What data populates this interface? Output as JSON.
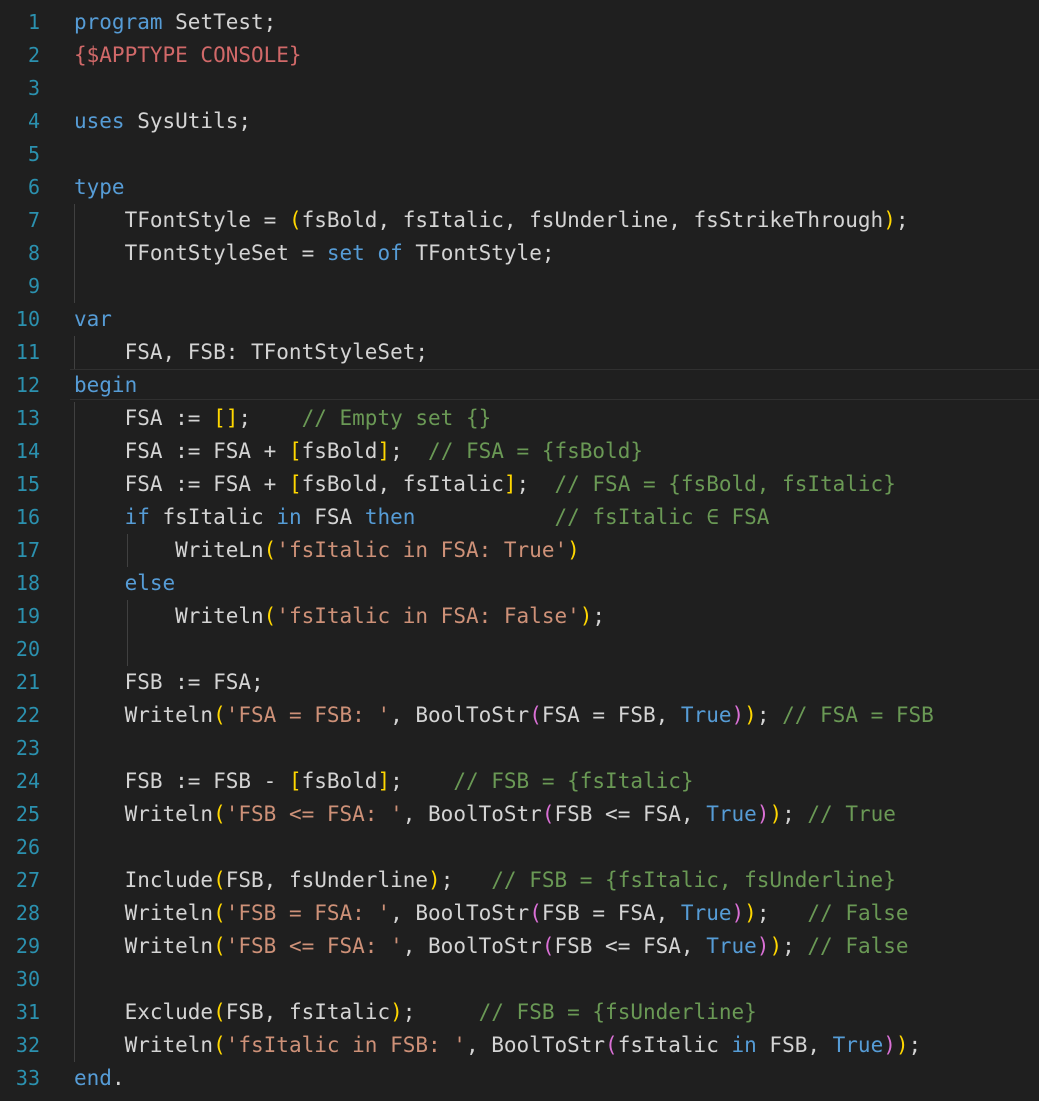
{
  "editor": {
    "line_numbers": [
      "1",
      "2",
      "3",
      "4",
      "5",
      "6",
      "7",
      "8",
      "9",
      "10",
      "11",
      "12",
      "13",
      "14",
      "15",
      "16",
      "17",
      "18",
      "19",
      "20",
      "21",
      "22",
      "23",
      "24",
      "25",
      "26",
      "27",
      "28",
      "29",
      "30",
      "31",
      "32",
      "33"
    ],
    "lines": [
      [
        {
          "t": "program",
          "c": "kw"
        },
        {
          "t": " SetTest;",
          "c": "txt"
        }
      ],
      [
        {
          "t": "{$APPTYPE CONSOLE}",
          "c": "dir"
        }
      ],
      [],
      [
        {
          "t": "uses",
          "c": "kw"
        },
        {
          "t": " SysUtils;",
          "c": "txt"
        }
      ],
      [],
      [
        {
          "t": "type",
          "c": "kw"
        }
      ],
      [
        {
          "t": "    TFontStyle = ",
          "c": "txt"
        },
        {
          "t": "(",
          "c": "brk"
        },
        {
          "t": "fsBold, fsItalic, fsUnderline, fsStrikeThrough",
          "c": "txt"
        },
        {
          "t": ")",
          "c": "brk"
        },
        {
          "t": ";",
          "c": "txt"
        }
      ],
      [
        {
          "t": "    TFontStyleSet = ",
          "c": "txt"
        },
        {
          "t": "set",
          "c": "kw"
        },
        {
          "t": " ",
          "c": "txt"
        },
        {
          "t": "of",
          "c": "kw"
        },
        {
          "t": " TFontStyle;",
          "c": "txt"
        }
      ],
      [],
      [
        {
          "t": "var",
          "c": "kw"
        }
      ],
      [
        {
          "t": "    FSA, FSB: TFontStyleSet;",
          "c": "txt"
        }
      ],
      [
        {
          "t": "begin",
          "c": "kw"
        }
      ],
      [
        {
          "t": "    FSA := ",
          "c": "txt"
        },
        {
          "t": "[]",
          "c": "brk"
        },
        {
          "t": ";    ",
          "c": "txt"
        },
        {
          "t": "// Empty set {}",
          "c": "cmt"
        }
      ],
      [
        {
          "t": "    FSA := FSA + ",
          "c": "txt"
        },
        {
          "t": "[",
          "c": "brk"
        },
        {
          "t": "fsBold",
          "c": "txt"
        },
        {
          "t": "]",
          "c": "brk"
        },
        {
          "t": ";  ",
          "c": "txt"
        },
        {
          "t": "// FSA = {fsBold}",
          "c": "cmt"
        }
      ],
      [
        {
          "t": "    FSA := FSA + ",
          "c": "txt"
        },
        {
          "t": "[",
          "c": "brk"
        },
        {
          "t": "fsBold, fsItalic",
          "c": "txt"
        },
        {
          "t": "]",
          "c": "brk"
        },
        {
          "t": ";  ",
          "c": "txt"
        },
        {
          "t": "// FSA = {fsBold, fsItalic}",
          "c": "cmt"
        }
      ],
      [
        {
          "t": "    ",
          "c": "txt"
        },
        {
          "t": "if",
          "c": "kw"
        },
        {
          "t": " fsItalic ",
          "c": "txt"
        },
        {
          "t": "in",
          "c": "kw"
        },
        {
          "t": " FSA ",
          "c": "txt"
        },
        {
          "t": "then",
          "c": "kw"
        },
        {
          "t": "           ",
          "c": "txt"
        },
        {
          "t": "// fsItalic ∈ FSA",
          "c": "cmt"
        }
      ],
      [
        {
          "t": "        WriteLn",
          "c": "txt"
        },
        {
          "t": "(",
          "c": "brk"
        },
        {
          "t": "'fsItalic in FSA: True'",
          "c": "str"
        },
        {
          "t": ")",
          "c": "brk"
        }
      ],
      [
        {
          "t": "    ",
          "c": "txt"
        },
        {
          "t": "else",
          "c": "kw"
        }
      ],
      [
        {
          "t": "        Writeln",
          "c": "txt"
        },
        {
          "t": "(",
          "c": "brk"
        },
        {
          "t": "'fsItalic in FSA: False'",
          "c": "str"
        },
        {
          "t": ")",
          "c": "brk"
        },
        {
          "t": ";",
          "c": "txt"
        }
      ],
      [],
      [
        {
          "t": "    FSB := FSA;",
          "c": "txt"
        }
      ],
      [
        {
          "t": "    Writeln",
          "c": "txt"
        },
        {
          "t": "(",
          "c": "brk"
        },
        {
          "t": "'FSA = FSB: '",
          "c": "str"
        },
        {
          "t": ", BoolToStr",
          "c": "txt"
        },
        {
          "t": "(",
          "c": "par"
        },
        {
          "t": "FSA = FSB, ",
          "c": "txt"
        },
        {
          "t": "True",
          "c": "kw"
        },
        {
          "t": ")",
          "c": "par"
        },
        {
          "t": ")",
          "c": "brk"
        },
        {
          "t": "; ",
          "c": "txt"
        },
        {
          "t": "// FSA = FSB",
          "c": "cmt"
        }
      ],
      [],
      [
        {
          "t": "    FSB := FSB - ",
          "c": "txt"
        },
        {
          "t": "[",
          "c": "brk"
        },
        {
          "t": "fsBold",
          "c": "txt"
        },
        {
          "t": "]",
          "c": "brk"
        },
        {
          "t": ";    ",
          "c": "txt"
        },
        {
          "t": "// FSB = {fsItalic}",
          "c": "cmt"
        }
      ],
      [
        {
          "t": "    Writeln",
          "c": "txt"
        },
        {
          "t": "(",
          "c": "brk"
        },
        {
          "t": "'FSB <= FSA: '",
          "c": "str"
        },
        {
          "t": ", BoolToStr",
          "c": "txt"
        },
        {
          "t": "(",
          "c": "par"
        },
        {
          "t": "FSB <= FSA, ",
          "c": "txt"
        },
        {
          "t": "True",
          "c": "kw"
        },
        {
          "t": ")",
          "c": "par"
        },
        {
          "t": ")",
          "c": "brk"
        },
        {
          "t": "; ",
          "c": "txt"
        },
        {
          "t": "// True",
          "c": "cmt"
        }
      ],
      [],
      [
        {
          "t": "    Include",
          "c": "txt"
        },
        {
          "t": "(",
          "c": "brk"
        },
        {
          "t": "FSB, fsUnderline",
          "c": "txt"
        },
        {
          "t": ")",
          "c": "brk"
        },
        {
          "t": ";   ",
          "c": "txt"
        },
        {
          "t": "// FSB = {fsItalic, fsUnderline}",
          "c": "cmt"
        }
      ],
      [
        {
          "t": "    Writeln",
          "c": "txt"
        },
        {
          "t": "(",
          "c": "brk"
        },
        {
          "t": "'FSB = FSA: '",
          "c": "str"
        },
        {
          "t": ", BoolToStr",
          "c": "txt"
        },
        {
          "t": "(",
          "c": "par"
        },
        {
          "t": "FSB = FSA, ",
          "c": "txt"
        },
        {
          "t": "True",
          "c": "kw"
        },
        {
          "t": ")",
          "c": "par"
        },
        {
          "t": ")",
          "c": "brk"
        },
        {
          "t": ";   ",
          "c": "txt"
        },
        {
          "t": "// False",
          "c": "cmt"
        }
      ],
      [
        {
          "t": "    Writeln",
          "c": "txt"
        },
        {
          "t": "(",
          "c": "brk"
        },
        {
          "t": "'FSB <= FSA: '",
          "c": "str"
        },
        {
          "t": ", BoolToStr",
          "c": "txt"
        },
        {
          "t": "(",
          "c": "par"
        },
        {
          "t": "FSB <= FSA, ",
          "c": "txt"
        },
        {
          "t": "True",
          "c": "kw"
        },
        {
          "t": ")",
          "c": "par"
        },
        {
          "t": ")",
          "c": "brk"
        },
        {
          "t": "; ",
          "c": "txt"
        },
        {
          "t": "// False",
          "c": "cmt"
        }
      ],
      [],
      [
        {
          "t": "    Exclude",
          "c": "txt"
        },
        {
          "t": "(",
          "c": "brk"
        },
        {
          "t": "FSB, fsItalic",
          "c": "txt"
        },
        {
          "t": ")",
          "c": "brk"
        },
        {
          "t": ";     ",
          "c": "txt"
        },
        {
          "t": "// FSB = {fsUnderline}",
          "c": "cmt"
        }
      ],
      [
        {
          "t": "    Writeln",
          "c": "txt"
        },
        {
          "t": "(",
          "c": "brk"
        },
        {
          "t": "'fsItalic in FSB: '",
          "c": "str"
        },
        {
          "t": ", BoolToStr",
          "c": "txt"
        },
        {
          "t": "(",
          "c": "par"
        },
        {
          "t": "fsItalic ",
          "c": "txt"
        },
        {
          "t": "in",
          "c": "kw"
        },
        {
          "t": " FSB, ",
          "c": "txt"
        },
        {
          "t": "True",
          "c": "kw"
        },
        {
          "t": ")",
          "c": "par"
        },
        {
          "t": ")",
          "c": "brk"
        },
        {
          "t": ";",
          "c": "txt"
        }
      ],
      [
        {
          "t": "end",
          "c": "kw"
        },
        {
          "t": ".",
          "c": "txt"
        }
      ]
    ]
  },
  "theme": {
    "background": "#1f1f1f",
    "line_number": "#2b91af",
    "keyword": "#569cd6",
    "string": "#ce9178",
    "comment": "#6a9955",
    "directive": "#d16969",
    "bracket_1": "#ffd700",
    "bracket_2": "#da70d6"
  }
}
